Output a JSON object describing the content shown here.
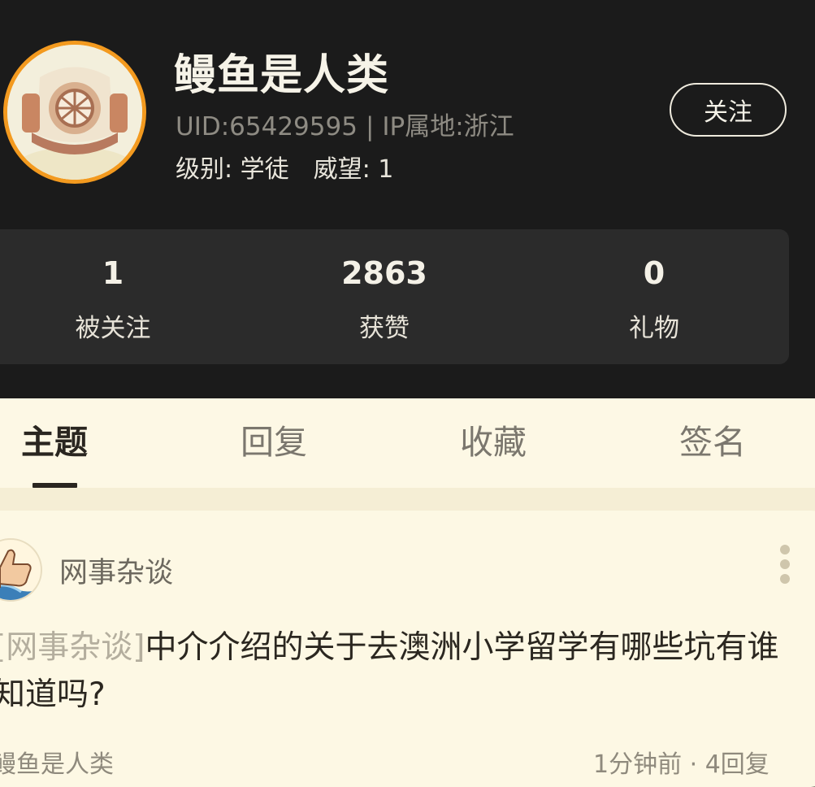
{
  "profile": {
    "name": "鳗鱼是人类",
    "uid": "UID:65429595",
    "separator": "|",
    "ip_location": "IP属地:浙江",
    "level_label": "级别: 学徒",
    "prestige_label": "威望: 1",
    "follow_button": "关注"
  },
  "stats": [
    {
      "value": "1",
      "label": "被关注"
    },
    {
      "value": "2863",
      "label": "获赞"
    },
    {
      "value": "0",
      "label": "礼物"
    }
  ],
  "tabs": [
    {
      "label": "主题",
      "active": true
    },
    {
      "label": "回复",
      "active": false
    },
    {
      "label": "收藏",
      "active": false
    },
    {
      "label": "签名",
      "active": false
    }
  ],
  "post": {
    "forum_icon": "thumbs-up-icon",
    "forum_name": "网事杂谈",
    "tag": "[网事杂谈]",
    "title": "中介介绍的关于去澳洲小学留学有哪些坑有谁知道吗?",
    "author_partial": "鳗鱼是人类",
    "meta_partial": "1分钟前 · 4回复"
  },
  "colors": {
    "accent": "#f39a1f",
    "header_bg": "#1b1b1b",
    "content_bg": "#fdf8e5"
  }
}
